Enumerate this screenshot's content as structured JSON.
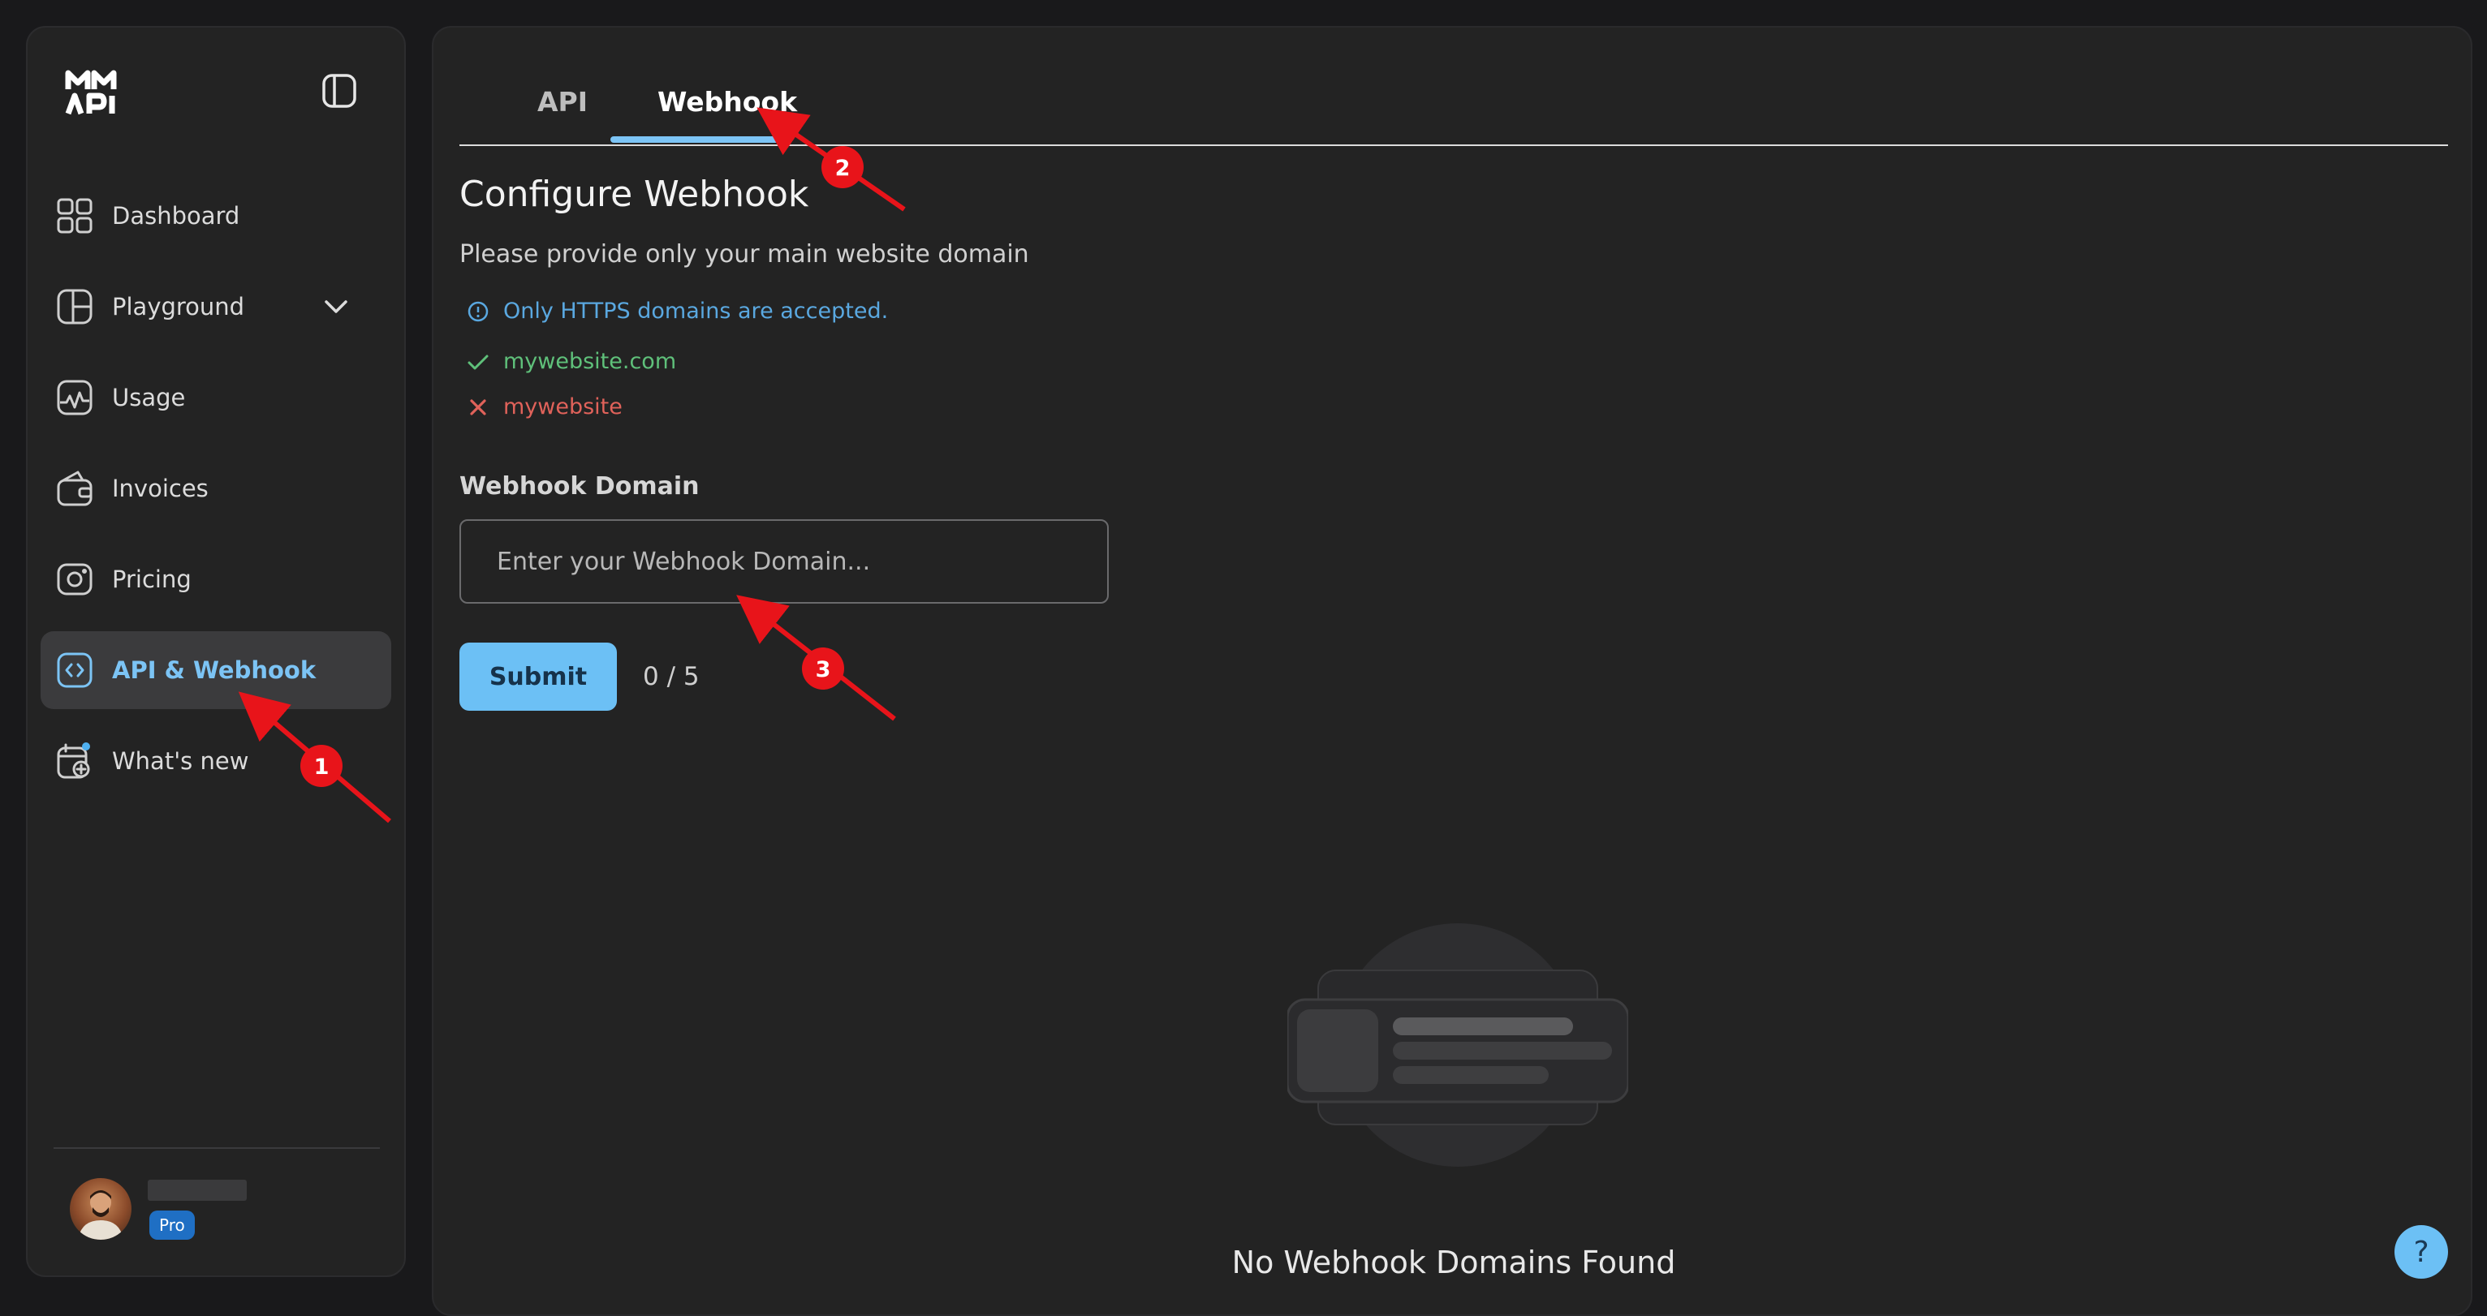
{
  "sidebar": {
    "logo_alt": "MI API",
    "items": [
      {
        "label": "Dashboard",
        "icon": "grid-icon"
      },
      {
        "label": "Playground",
        "icon": "layout-icon"
      },
      {
        "label": "Usage",
        "icon": "activity-icon"
      },
      {
        "label": "Invoices",
        "icon": "wallet-icon"
      },
      {
        "label": "Pricing",
        "icon": "camera-icon"
      },
      {
        "label": "API & Webhook",
        "icon": "code-icon"
      },
      {
        "label": "What's new",
        "icon": "calendar-plus-icon"
      }
    ],
    "user": {
      "plan_badge": "Pro"
    }
  },
  "tabs": [
    {
      "label": "API"
    },
    {
      "label": "Webhook"
    }
  ],
  "main": {
    "title": "Configure Webhook",
    "subtitle": "Please provide only your main website domain",
    "rules": {
      "info": "Only HTTPS domains are accepted.",
      "valid_example": "mywebsite.com",
      "invalid_example": "mywebsite"
    },
    "field_label": "Webhook Domain",
    "input_placeholder": "Enter your Webhook Domain...",
    "submit_label": "Submit",
    "counter": "0 / 5",
    "empty_state": "No Webhook Domains Found",
    "help_label": "?"
  },
  "annotations": [
    "1",
    "2",
    "3"
  ],
  "colors": {
    "accent": "#6cc0f5",
    "active_text": "#7cc4f5",
    "success": "#5fc07a",
    "error": "#e0625a",
    "info": "#5aa8e0",
    "annotation": "#e8141a"
  }
}
